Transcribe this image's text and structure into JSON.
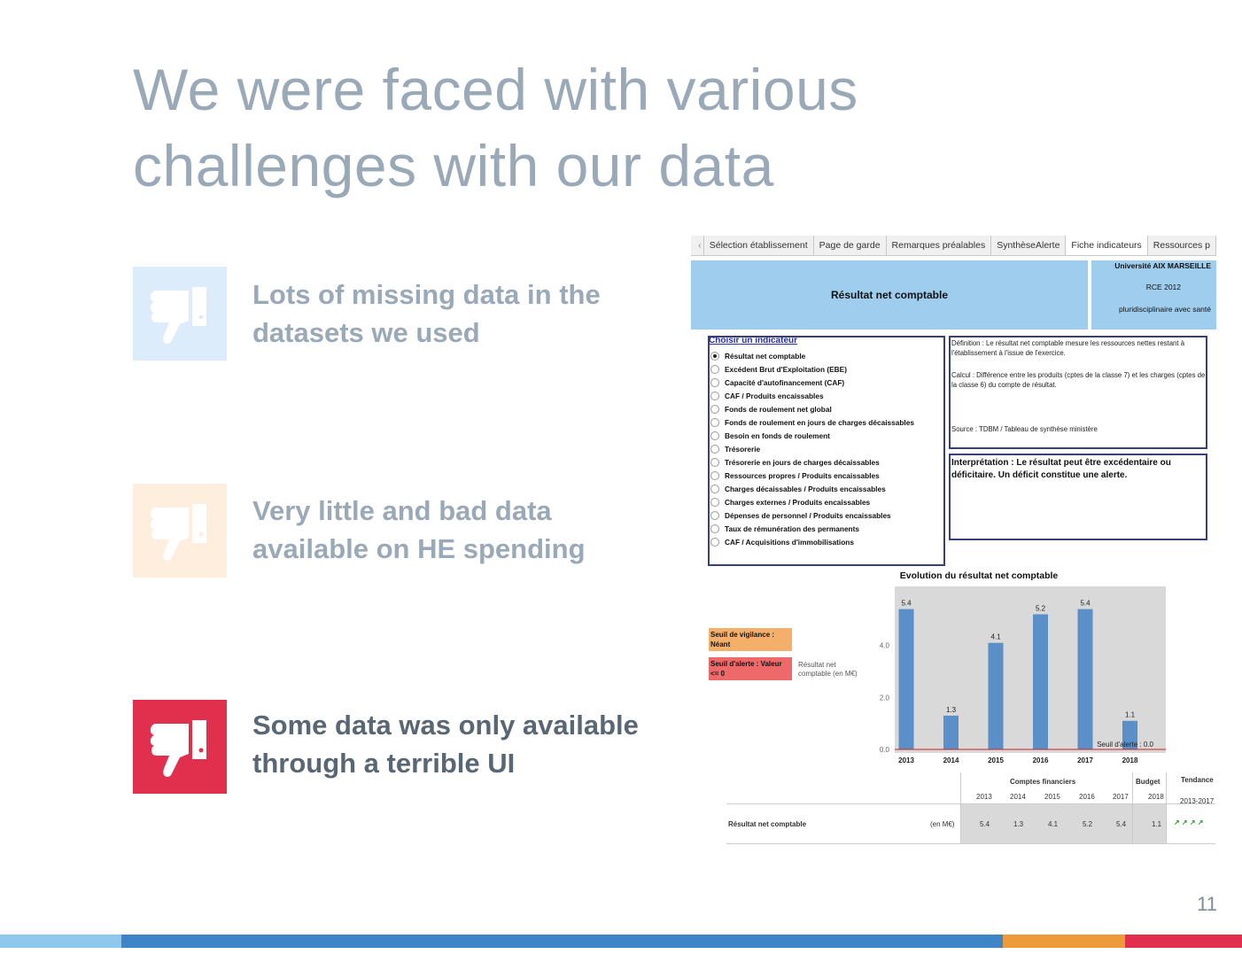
{
  "slide": {
    "title_line1": "We were faced with various",
    "title_line2": "challenges with our data",
    "page_number": "11",
    "points": [
      {
        "text": "Lots of missing data in the datasets we used",
        "icon": "thumbs-down-icon",
        "tile_color": "#dcecfa",
        "text_color": "#9aa9b7"
      },
      {
        "text": "Very little and bad data available on HE spending",
        "icon": "thumbs-down-icon",
        "tile_color": "#fdeedd",
        "text_color": "#9aa9b7"
      },
      {
        "text": "Some data was only available through a terrible UI",
        "icon": "thumbs-down-icon",
        "tile_color": "#e0304e",
        "text_color": "#596673"
      }
    ],
    "bottom_bar_colors": [
      "#8fc8ef",
      "#3d85c6",
      "#ec9a3a",
      "#e0304e"
    ]
  },
  "screenshot": {
    "tabs": [
      "Sélection établissement",
      "Page de garde",
      "Remarques préalables",
      "SynthèseAlerte",
      "Fiche indicateurs",
      "Ressources p"
    ],
    "active_tab": "Fiche indicateurs",
    "header_title": "Résultat net comptable",
    "university": "Université AIX MARSEILLE",
    "rce": "RCE 2012",
    "type": "pluridisciplinaire avec santé",
    "indicator_title": "Choisir un indicateur",
    "indicators": [
      "Résultat net comptable",
      "Excédent Brut d'Exploitation (EBE)",
      "Capacité d'autofinancement (CAF)",
      "CAF / Produits encaissables",
      "Fonds de roulement net global",
      "Fonds de roulement en jours de charges décaissables",
      "Besoin en fonds de roulement",
      "Trésorerie",
      "Trésorerie en jours de charges décaissables",
      "Ressources propres / Produits encaissables",
      "Charges décaissables / Produits encaissables",
      "Charges externes / Produits encaissables",
      "Dépenses de personnel / Produits encaissables",
      "Taux de rémunération des permanents",
      "CAF / Acquisitions d'immobilisations"
    ],
    "selected_indicator": 0,
    "definition_1": "Définition : Le résultat net comptable mesure les ressources nettes restant à l'établissement à l'issue de l'exercice.",
    "definition_2": "Calcul : Différence entre les produits (cptes de la classe 7) et les charges (cptes de la classe 6) du compte de résultat.",
    "definition_3": "Source : TDBM / Tableau de synthèse ministère",
    "interpretation": "Interprétation : Le résultat peut être excédentaire ou déficitaire. Un déficit constitue une alerte.",
    "seuil_vigilance": "Seuil de vigilance : Néant",
    "seuil_alerte": "Seuil d'alerte : Valeur <= 0",
    "seuil_vigilance_color": "#f4b06a",
    "seuil_alerte_color": "#ee6a6a",
    "series_label": "Résultat net comptable (en M€)",
    "table_group_1": "Comptes financiers",
    "table_group_2": "Budget",
    "table_group_3": "Tendance",
    "table_period": "2013-2017",
    "table_row_label": "Résultat net comptable",
    "table_unit": "(en M€)",
    "table_years": [
      "2013",
      "2014",
      "2015",
      "2016",
      "2017",
      "2018"
    ],
    "table_values": [
      "5.4",
      "1.3",
      "4.1",
      "5.2",
      "5.4",
      "1.1"
    ],
    "trend_arrows": "↗ ↗ ↗ ↗"
  },
  "chart_data": {
    "type": "bar",
    "title": "Evolution du résultat net comptable",
    "categories": [
      "2013",
      "2014",
      "2015",
      "2016",
      "2017",
      "2018"
    ],
    "values": [
      5.4,
      1.3,
      4.1,
      5.2,
      5.4,
      1.1
    ],
    "data_labels": [
      "5.4",
      "1.3",
      "4.1",
      "5.2",
      "5.4",
      "1.1"
    ],
    "y_ticks": [
      "0.0",
      "2.0",
      "4.0"
    ],
    "ylim": [
      0,
      6
    ],
    "threshold_label": "Seuil d'alerte : 0.0",
    "threshold_value": 0,
    "bar_color": "#5b8fc7",
    "threshold_color": "#cc2222",
    "grid": false
  }
}
